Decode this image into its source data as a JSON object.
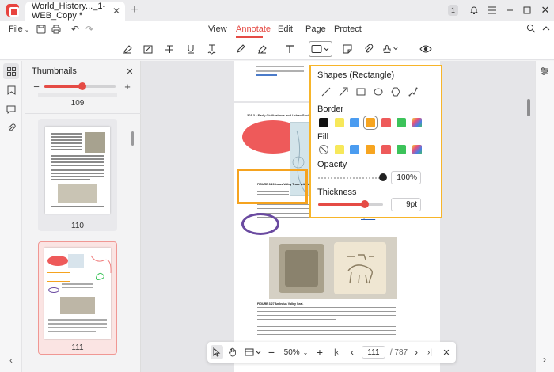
{
  "titlebar": {
    "tab_title": "World_History..._1-WEB_Copy *",
    "page_badge": "1"
  },
  "menubar": {
    "file": "File",
    "items": [
      "View",
      "Annotate",
      "Edit",
      "Page",
      "Protect"
    ],
    "active": "Annotate"
  },
  "sidebar": {
    "title": "Thumbnails",
    "zoom_level": 0.5,
    "pages": [
      "109",
      "110",
      "111"
    ]
  },
  "popup": {
    "title": "Shapes (Rectangle)",
    "border_label": "Border",
    "fill_label": "Fill",
    "opacity_label": "Opacity",
    "opacity_value": "100%",
    "opacity_level": 1.0,
    "thickness_label": "Thickness",
    "thickness_value": "9pt",
    "thickness_level": 0.55,
    "border_colors": [
      "#111111",
      "#f7e85a",
      "#4b9cf0",
      "#f7a520",
      "#ee5a5a",
      "#3cc35a",
      "gradient"
    ],
    "fill_colors": [
      "none",
      "#f7e85a",
      "#4b9cf0",
      "#f7a520",
      "#ee5a5a",
      "#3cc35a",
      "gradient"
    ],
    "selected_border": 3
  },
  "bottombar": {
    "zoom": "50%",
    "current_page": "111",
    "total_pages": "/ 787"
  },
  "document": {
    "header": "301   3 • Early Civilizations and Urban Societies",
    "figure_caption_1": "FIGURE 3.26 Indus Valley Trade with Mesopotamia.",
    "figure_caption_2": "FIGURE 3.27 An Indus Valley Seal.",
    "link_text": "Figure 3.27"
  },
  "colors": {
    "accent": "#e54b45",
    "popup_border": "#f7b52a",
    "annotation_orange": "#f5a31f",
    "annotation_purple": "#6a4aa0",
    "annotation_red": "#f05a5a"
  }
}
